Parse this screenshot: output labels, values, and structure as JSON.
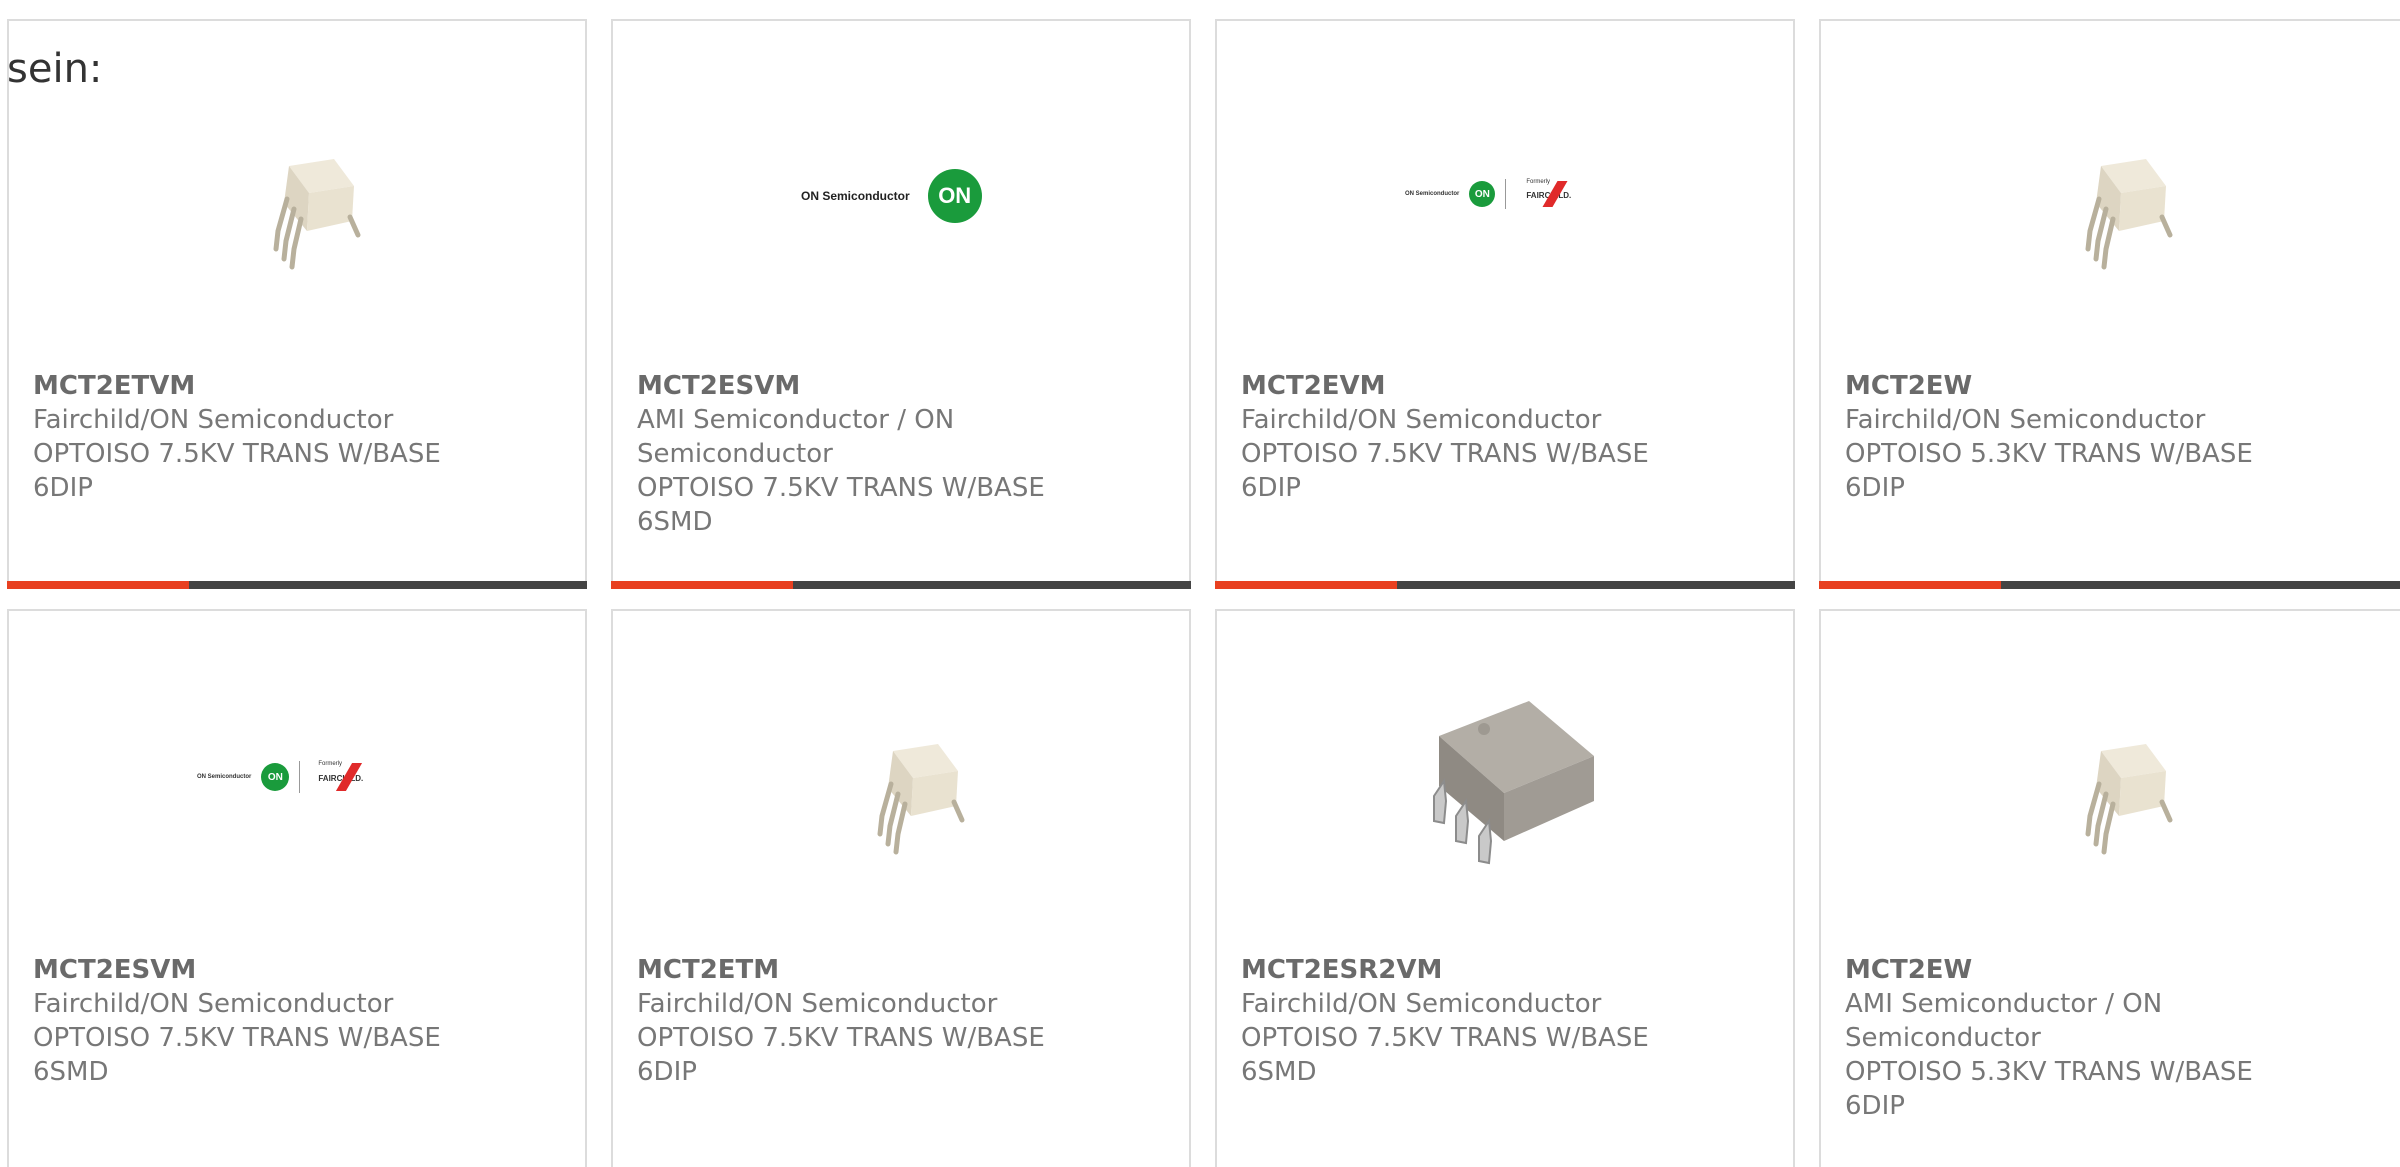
{
  "intro_text": "sein:",
  "products": [
    {
      "part": "MCT2ETVM",
      "manufacturer": "Fairchild/ON Semiconductor",
      "description": "OPTOISO 7.5KV TRANS W/BASE",
      "package": "6DIP",
      "image": "dip6-chip-icon"
    },
    {
      "part": "MCT2ESVM",
      "manufacturer_lines": [
        "AMI Semiconductor / ON",
        "Semiconductor"
      ],
      "description": "OPTOISO 7.5KV TRANS W/BASE",
      "package": "6SMD",
      "image": "on-semiconductor-logo",
      "logo_text": "ON Semiconductor",
      "logo_mark": "ON"
    },
    {
      "part": "MCT2EVM",
      "manufacturer": "Fairchild/ON Semiconductor",
      "description": "OPTOISO 7.5KV TRANS W/BASE",
      "package": "6DIP",
      "image": "on-fairchild-logo",
      "logo_text": "ON Semiconductor",
      "logo_mark": "ON",
      "formerly": "Formerly",
      "fairchild": "FAIRCHILD."
    },
    {
      "part": "MCT2EW",
      "manufacturer": "Fairchild/ON Semiconductor",
      "description": "OPTOISO 5.3KV TRANS W/BASE",
      "package": "6DIP",
      "image": "dip6-chip-icon"
    },
    {
      "part": "MCT2ESVM",
      "manufacturer": "Fairchild/ON Semiconductor",
      "description": "OPTOISO 7.5KV TRANS W/BASE",
      "package": "6SMD",
      "image": "on-fairchild-logo",
      "logo_text": "ON Semiconductor",
      "logo_mark": "ON",
      "formerly": "Formerly",
      "fairchild": "FAIRCHILD."
    },
    {
      "part": "MCT2ETM",
      "manufacturer": "Fairchild/ON Semiconductor",
      "description": "OPTOISO 7.5KV TRANS W/BASE",
      "package": "6DIP",
      "image": "dip6-chip-icon"
    },
    {
      "part": "MCT2ESR2VM",
      "manufacturer": "Fairchild/ON Semiconductor",
      "description": "OPTOISO 7.5KV TRANS W/BASE",
      "package": "6SMD",
      "image": "smd6-chip-icon"
    },
    {
      "part": "MCT2EW",
      "manufacturer_lines": [
        "AMI Semiconductor / ON",
        "Semiconductor"
      ],
      "description": "OPTOISO 5.3KV TRANS W/BASE",
      "package": "6DIP",
      "image": "dip6-chip-icon"
    }
  ],
  "colors": {
    "accent": "#e84020",
    "bar_dark": "#444444",
    "card_border": "#dcdcdc",
    "text": "#777777",
    "on_green": "#1a9b3c",
    "fairchild_red": "#e02a2a"
  }
}
